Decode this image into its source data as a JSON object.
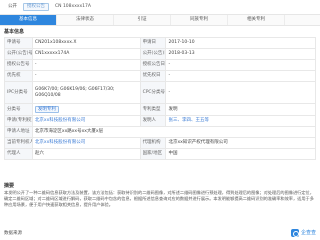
{
  "topbar": {
    "chips": [
      {
        "label": "公开",
        "style": "plain"
      },
      {
        "label": "授权公告",
        "style": "chip"
      },
      {
        "label": "CN 108xxxx17A",
        "style": "plain"
      }
    ]
  },
  "tabs": [
    {
      "label": "基本信息",
      "active": true
    },
    {
      "label": "法律状态",
      "active": false
    },
    {
      "label": "引证",
      "active": false
    },
    {
      "label": "同族专利",
      "active": false
    },
    {
      "label": "相关专利",
      "active": false
    }
  ],
  "section_title": "基本信息",
  "fields": {
    "r1": {
      "k1": "申请号",
      "v1": "CN201x108xxxx.X",
      "k2": "申请日",
      "v2": "2017-10-10"
    },
    "r2": {
      "k1": "公开(公告)号",
      "v1": "CN1xxxxx174A",
      "k2": "公开(公告)日",
      "v2": "2018-03-13"
    },
    "r3": {
      "k1": "授权公告号",
      "v1": "-",
      "k2": "授权公告日",
      "v2": "-"
    },
    "r4": {
      "k1": "优先权",
      "v1": "-",
      "k2": "优先权日",
      "v2": "-"
    },
    "r5": {
      "k1": "IPC分类号",
      "v1": "G06K7/00; G06K19/06; G06F17/30; G06Q10/08",
      "k2": "CPC分类号",
      "v2": "-"
    },
    "r6": {
      "k1": "分类号",
      "tags": [
        "发明专利"
      ],
      "k2": "专利类型",
      "v2": "发明"
    },
    "r7": {
      "k1": "申请(专利权)人",
      "v1": "北京xx科技股份有限公司",
      "k2": "发明人",
      "v2": "张三、李四、王五等"
    },
    "r8": {
      "k1": "申请人地址",
      "v1": "北京市海淀区xx路xx号xx大厦x层"
    },
    "r9": {
      "k1": "当前专利权人",
      "v1": "北京xx科技股份有限公司",
      "k2": "代理机构",
      "v2": "北京xx知识产权代理有限公司"
    },
    "r10": {
      "k1": "代理人",
      "v1": "赵六",
      "k2": "国家/地区",
      "v2": "中国"
    }
  },
  "abstract_title": "摘要",
  "abstract_text": "本发明公开了一种二维码信息获取方法及装置，该方法包括：获取待识别的二维码图像，对所述二维码图像进行预处理，得到处理后的图像；对处理后的图像进行定位，确定二维码区域；对二维码区域进行解码，获取二维码中包含的信息，根据所述信息查询对应的数据并进行展示。本发明能够提高二维码识别的准确率和效率，适用于多种应用场景，便于用户快速获取相关信息，提升用户体验。",
  "footer_left": "数据来源",
  "footer_right": "企查查",
  "colors": {
    "accent": "#2e86de",
    "link": "#3a7bd5"
  }
}
